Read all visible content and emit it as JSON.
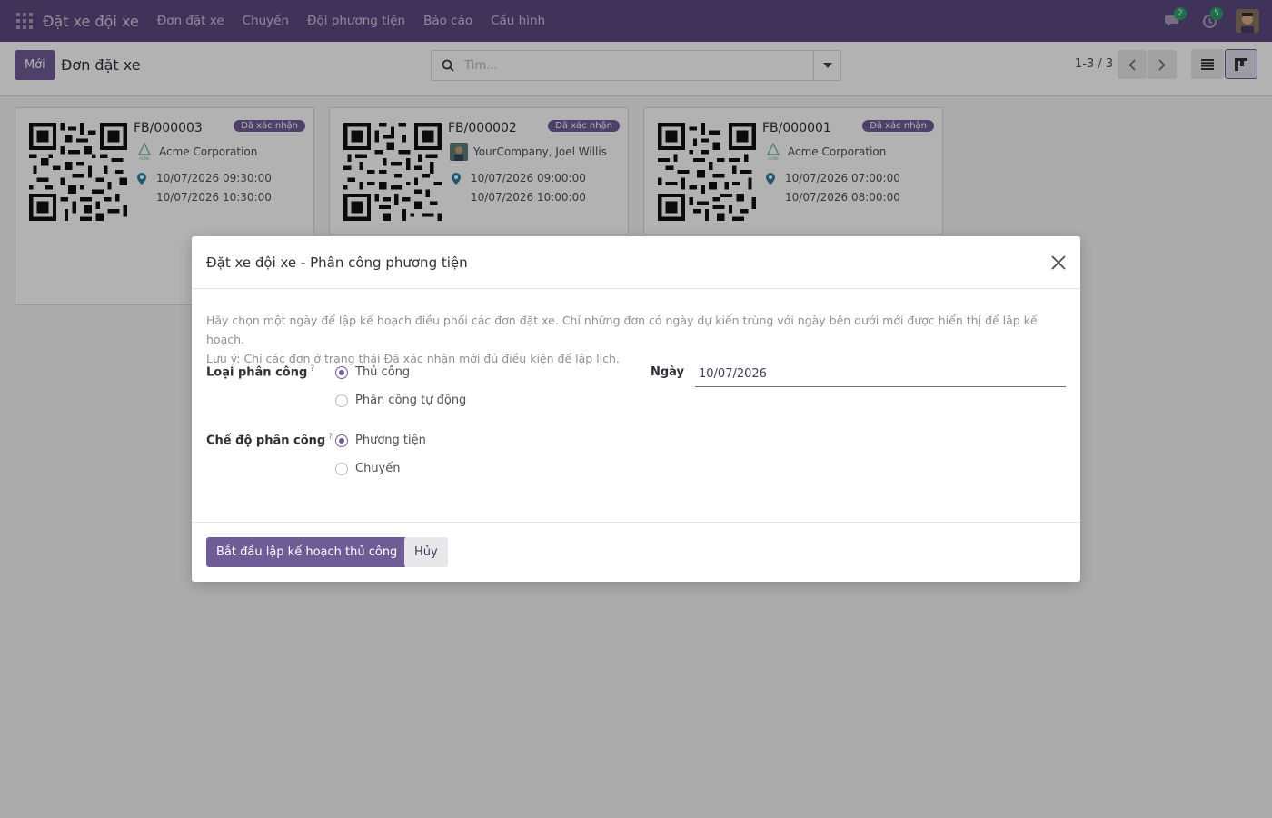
{
  "navbar": {
    "app_title": "Đặt xe đội xe",
    "menu": [
      "Đơn đặt xe",
      "Chuyến",
      "Đội phương tiện",
      "Báo cáo",
      "Cấu hình"
    ],
    "messages_count": "2",
    "activities_count": "5"
  },
  "control_panel": {
    "new_button": "Mới",
    "title": "Đơn đặt xe",
    "search_placeholder": "Tìm...",
    "pager": "1-3 / 3"
  },
  "cards": [
    {
      "ref": "FB/000003",
      "status": "Đã xác nhận",
      "partner": "Acme Corporation",
      "partner_logo": "acme-logo",
      "start": "10/07/2026 09:30:00",
      "end": "10/07/2026 10:30:00"
    },
    {
      "ref": "FB/000002",
      "status": "Đã xác nhận",
      "partner": "YourCompany, Joel Willis",
      "partner_logo": "person-avatar",
      "start": "10/07/2026 09:00:00",
      "end": "10/07/2026 10:00:00"
    },
    {
      "ref": "FB/000001",
      "status": "Đã xác nhận",
      "partner": "Acme Corporation",
      "partner_logo": "acme-logo",
      "start": "10/07/2026 07:00:00",
      "end": "10/07/2026 08:00:00"
    }
  ],
  "dialog": {
    "title": "Đặt xe đội xe - Phân công phương tiện",
    "help_line1": "Hãy chọn một ngày để lập kế hoạch điều phối các đơn đặt xe. Chỉ những đơn có ngày dự kiến trùng với ngày bên dưới mới được hiển thị để lập kế hoạch.",
    "help_line2": "Lưu ý: Chỉ các đơn ở trạng thái Đã xác nhận mới đủ điều kiện để lập lịch.",
    "assign_type_label": "Loại phân công",
    "assign_type_options": [
      "Thủ công",
      "Phân công tự động"
    ],
    "assign_type_selected": "Thủ công",
    "assign_mode_label": "Chế độ phân công",
    "assign_mode_options": [
      "Phương tiện",
      "Chuyến"
    ],
    "assign_mode_selected": "Phương tiện",
    "date_label": "Ngày",
    "date_value": "10/07/2026",
    "help_marker": "?",
    "primary_button": "Bắt đầu lập kế hoạch thủ công",
    "cancel_button": "Hủy"
  },
  "colors": {
    "brand": "#5c4a80",
    "accent": "#6f5c97"
  }
}
